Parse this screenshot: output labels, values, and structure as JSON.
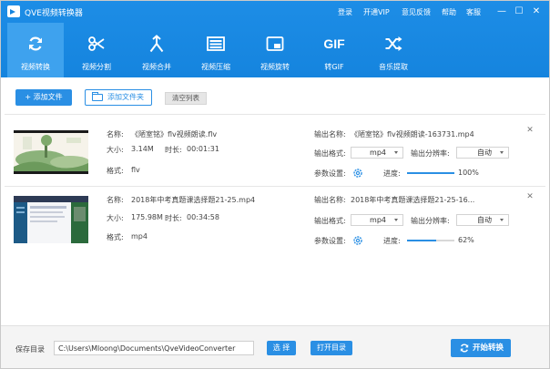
{
  "window": {
    "title": "QVE视频转换器",
    "links": [
      "登录",
      "开通VIP",
      "意见反馈",
      "帮助",
      "客服"
    ],
    "controls": [
      "—",
      "☐",
      "✕"
    ]
  },
  "toolbar": {
    "items": [
      {
        "label": "视频转换",
        "icon": "refresh-icon",
        "active": true
      },
      {
        "label": "视频分割",
        "icon": "scissors-icon"
      },
      {
        "label": "视频合并",
        "icon": "merge-icon"
      },
      {
        "label": "视频压缩",
        "icon": "compress-icon"
      },
      {
        "label": "视频旋转",
        "icon": "rotate-icon"
      },
      {
        "label": "转GIF",
        "icon": "gif-icon",
        "glyph": "GIF"
      },
      {
        "label": "音乐提取",
        "icon": "shuffle-icon"
      }
    ]
  },
  "actions": {
    "add_file": "+ 添加文件",
    "add_folder": "添加文件夹",
    "clear_list": "清空列表"
  },
  "labels": {
    "name": "名称:",
    "size": "大小:",
    "duration": "时长:",
    "format": "格式:",
    "output_name": "输出名称:",
    "output_format": "输出格式:",
    "output_resolution": "输出分辨率:",
    "params": "参数设置:",
    "progress": "进度:"
  },
  "files": [
    {
      "name": "《陋室铭》flv视频朗读.flv",
      "size": "3.14M",
      "duration": "00:01:31",
      "format": "flv",
      "output_name": "《陋室铭》flv视频朗读-163731.mp4",
      "output_format": "mp4",
      "output_resolution": "自动",
      "progress": 100,
      "progress_label": "100%"
    },
    {
      "name": "2018年中考真题课选择题21-25.mp4",
      "size": "175.98M",
      "duration": "00:34:58",
      "format": "mp4",
      "output_name": "2018年中考真题课选择题21-25-16...",
      "output_format": "mp4",
      "output_resolution": "自动",
      "progress": 62,
      "progress_label": "62%"
    }
  ],
  "footer": {
    "save_label": "保存目录",
    "save_path": "C:\\Users\\Mloong\\Documents\\QveVideoConverter",
    "choose": "选 择",
    "open_dir": "打开目录",
    "start": "开始转换"
  },
  "colors": {
    "primary": "#1584de",
    "accent": "#2a8fe4",
    "active_tab": "#3ea2ee"
  }
}
